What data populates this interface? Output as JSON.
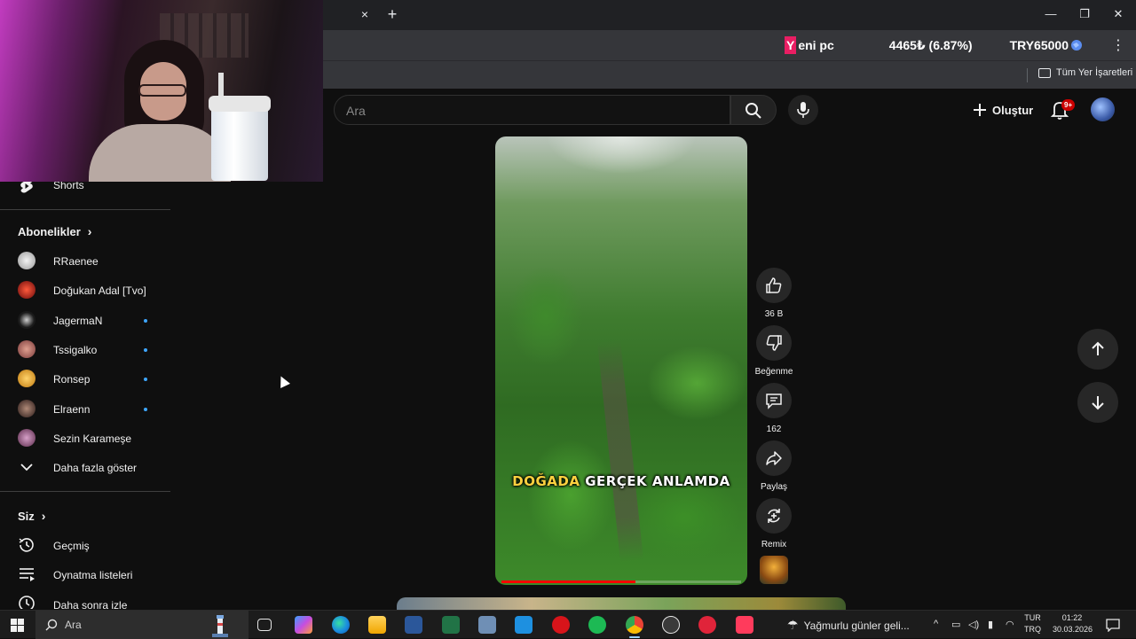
{
  "browser": {
    "tab_close": "×",
    "new_tab": "+",
    "window": {
      "minimize": "—",
      "maximize": "❐",
      "close": "✕"
    },
    "ticker": {
      "tag_first": "Y",
      "tag_rest": "eni pc",
      "change": "4465₺ (6.87%)",
      "target": "TRY65000"
    },
    "bookmarks": {
      "all_bookmarks": "Tüm Yer İşaretleri"
    }
  },
  "youtube": {
    "search": {
      "placeholder": "Ara"
    },
    "header": {
      "create_label": "Oluştur",
      "notifications_badge": "9+"
    },
    "sidebar": {
      "shorts_label": "Shorts",
      "subscriptions_title": "Abonelikler",
      "subscriptions": [
        {
          "name": "RRaenee",
          "new": false
        },
        {
          "name": "Doğukan Adal [Tvo]",
          "new": false
        },
        {
          "name": "JagermaN",
          "new": true
        },
        {
          "name": "Tssigalko",
          "new": true
        },
        {
          "name": "Ronsep",
          "new": true
        },
        {
          "name": "Elraenn",
          "new": true
        },
        {
          "name": "Sezin Karameşe",
          "new": false
        }
      ],
      "show_more": "Daha fazla göster",
      "you_title": "Siz",
      "you_items": [
        "Geçmiş",
        "Oynatma listeleri",
        "Daha sonra izle"
      ]
    },
    "short": {
      "caption_highlight": "DOĞADA",
      "caption_rest": "GERÇEK ANLAMDA",
      "progress_fraction": 0.56
    },
    "actions": {
      "like_count": "36 B",
      "dislike_label": "Beğenme",
      "comments_count": "162",
      "share_label": "Paylaş",
      "remix_label": "Remix"
    }
  },
  "taskbar": {
    "search_placeholder": "Ara",
    "weather_text": "Yağmurlu günler geli...",
    "lang_top": "TUR",
    "lang_bottom": "TRQ",
    "time": "01:22",
    "date": "30.03.2026"
  },
  "colors": {
    "background": "#0f0f0f",
    "accent_red": "#ff0000",
    "caption_yellow": "#ffd23f",
    "new_dot_blue": "#3ea6ff"
  }
}
